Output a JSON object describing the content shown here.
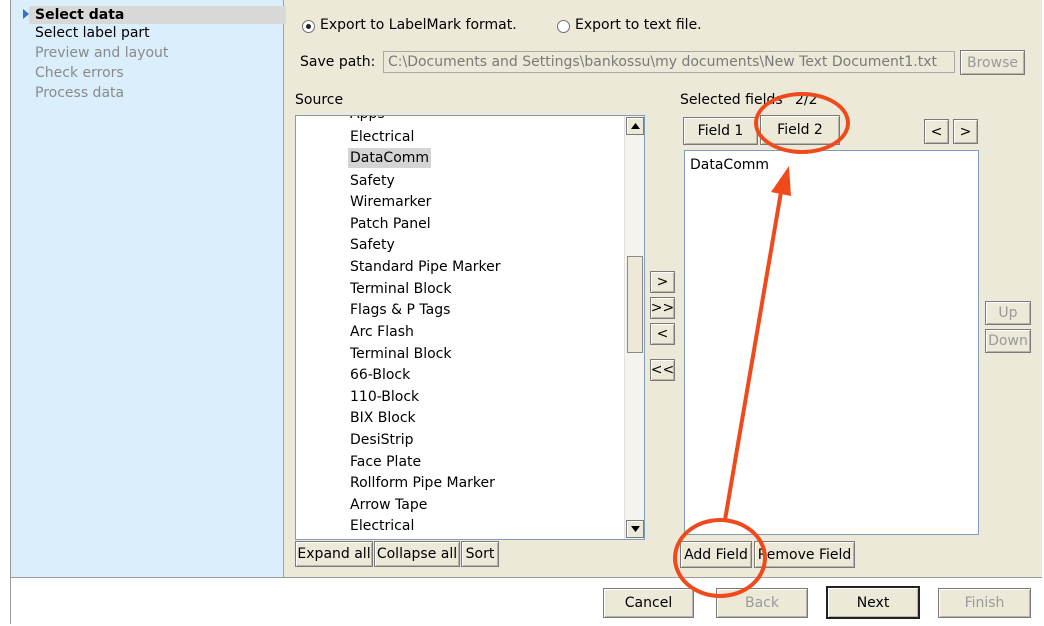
{
  "steps": [
    {
      "label": "Select data",
      "state": "active"
    },
    {
      "label": "Select label part",
      "state": "normal"
    },
    {
      "label": "Preview and layout",
      "state": "disabled"
    },
    {
      "label": "Check errors",
      "state": "disabled"
    },
    {
      "label": "Process data",
      "state": "disabled"
    }
  ],
  "export": {
    "option_labelmark": "Export to LabelMark format.",
    "option_text": "Export to text file.",
    "selected": "labelmark"
  },
  "save_path": {
    "label": "Save path:",
    "value": "C:\\Documents and Settings\\bankossu\\my documents\\New Text Document1.txt",
    "browse_label": "Browse"
  },
  "source": {
    "label": "Source",
    "partial_top": "Apps",
    "items": [
      "Electrical",
      "DataComm",
      "Safety",
      "Wiremarker",
      "Patch Panel",
      "Safety",
      "Standard Pipe Marker",
      "Terminal Block",
      "Flags & P Tags",
      "Arc Flash",
      "Terminal Block",
      "66-Block",
      "110-Block",
      "BIX Block",
      "DesiStrip",
      "Face Plate",
      "Rollform Pipe Marker",
      "Arrow Tape",
      "Electrical"
    ],
    "selected_item": "DataComm",
    "expand_all": "Expand all",
    "collapse_all": "Collapse all",
    "sort": "Sort"
  },
  "transfer": {
    "add_one": ">",
    "add_all": ">>",
    "remove_one": "<",
    "remove_all": "<<"
  },
  "selected_fields": {
    "label": "Selected fields",
    "count": "2/2",
    "tabs": [
      "Field 1",
      "Field 2"
    ],
    "active_tab": "Field 2",
    "prev": "<",
    "next": ">",
    "content": "DataComm",
    "add_field": "Add Field",
    "remove_field": "Remove Field",
    "up": "Up",
    "down": "Down"
  },
  "footer": {
    "cancel": "Cancel",
    "back": "Back",
    "next": "Next",
    "finish": "Finish"
  },
  "colors": {
    "annotation": "#f04a1c",
    "steps_bg": "#dbeefc",
    "dialog_bg": "#ece9d8"
  }
}
